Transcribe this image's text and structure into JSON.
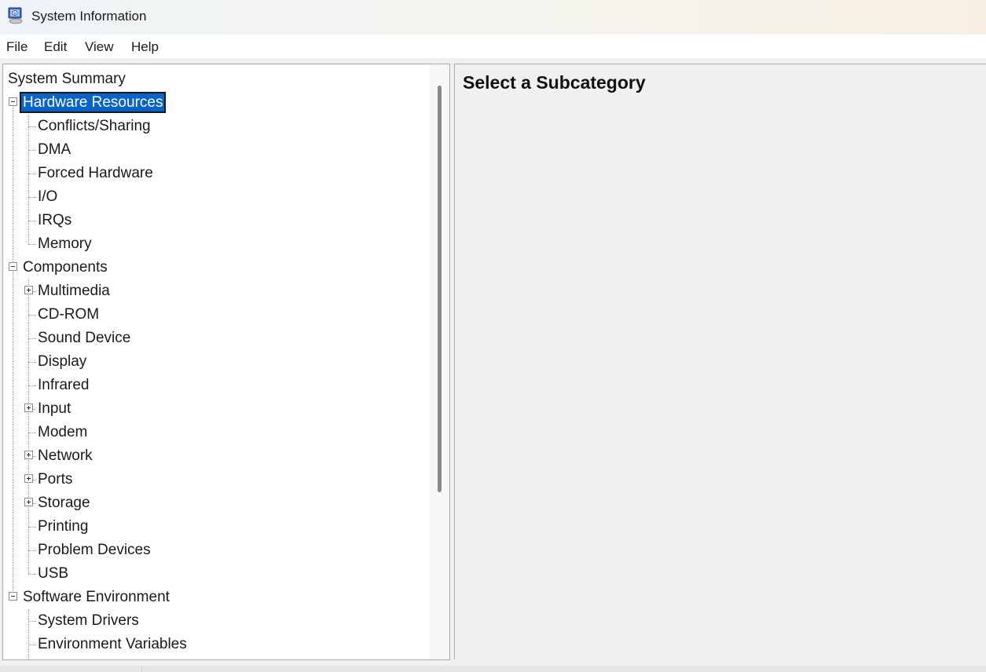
{
  "window": {
    "title": "System Information"
  },
  "menu": [
    "File",
    "Edit",
    "View",
    "Help"
  ],
  "tree": {
    "root": "System Summary",
    "groups": [
      {
        "label": "Hardware Resources",
        "selected": true,
        "children": [
          {
            "label": "Conflicts/Sharing",
            "expandable": false
          },
          {
            "label": "DMA",
            "expandable": false
          },
          {
            "label": "Forced Hardware",
            "expandable": false
          },
          {
            "label": "I/O",
            "expandable": false
          },
          {
            "label": "IRQs",
            "expandable": false
          },
          {
            "label": "Memory",
            "expandable": false
          }
        ]
      },
      {
        "label": "Components",
        "selected": false,
        "children": [
          {
            "label": "Multimedia",
            "expandable": true
          },
          {
            "label": "CD-ROM",
            "expandable": false
          },
          {
            "label": "Sound Device",
            "expandable": false
          },
          {
            "label": "Display",
            "expandable": false
          },
          {
            "label": "Infrared",
            "expandable": false
          },
          {
            "label": "Input",
            "expandable": true
          },
          {
            "label": "Modem",
            "expandable": false
          },
          {
            "label": "Network",
            "expandable": true
          },
          {
            "label": "Ports",
            "expandable": true
          },
          {
            "label": "Storage",
            "expandable": true
          },
          {
            "label": "Printing",
            "expandable": false
          },
          {
            "label": "Problem Devices",
            "expandable": false
          },
          {
            "label": "USB",
            "expandable": false
          }
        ]
      },
      {
        "label": "Software Environment",
        "selected": false,
        "children": [
          {
            "label": "System Drivers",
            "expandable": false
          },
          {
            "label": "Environment Variables",
            "expandable": false
          }
        ]
      }
    ]
  },
  "content": {
    "heading": "Select a Subcategory"
  },
  "colors": {
    "selection": "#0a64c8",
    "pane_bg": "#f0f0f0"
  }
}
